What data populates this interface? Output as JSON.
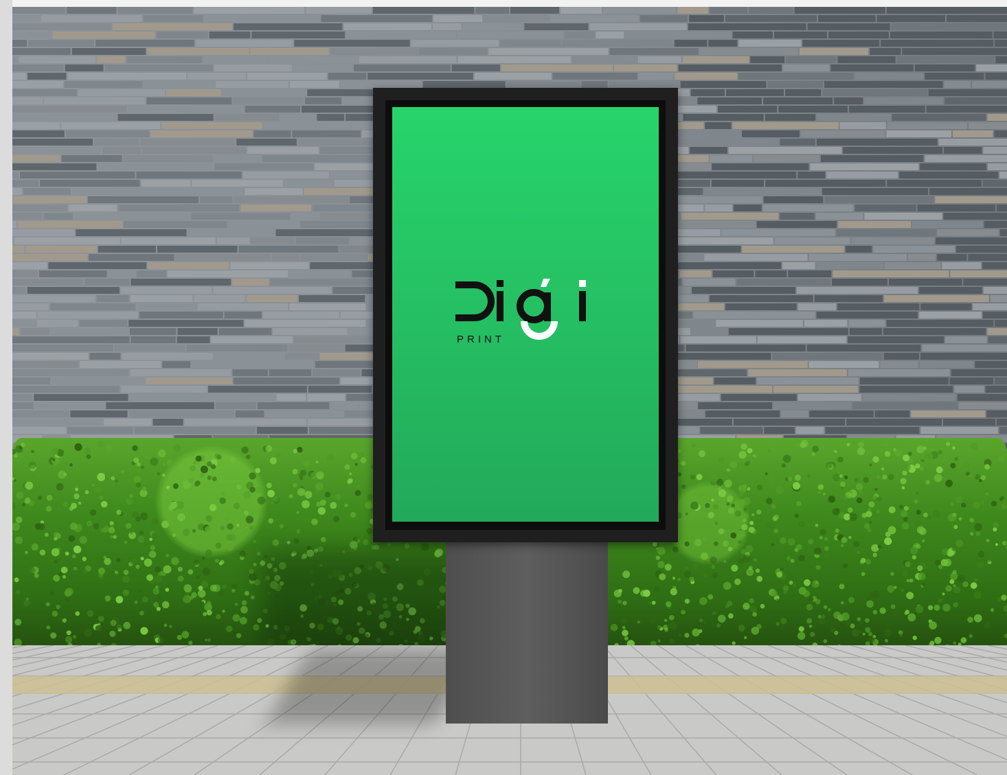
{
  "scene": {
    "description_type": "street-poster-mockup"
  },
  "poster": {
    "logo": {
      "wordmark": "Digi",
      "subtitle": "PRINT"
    },
    "colors": {
      "panel_top": "#27d46b",
      "panel_bottom": "#22a95a",
      "logo_dark": "#111111",
      "logo_light": "#ffffff"
    }
  }
}
